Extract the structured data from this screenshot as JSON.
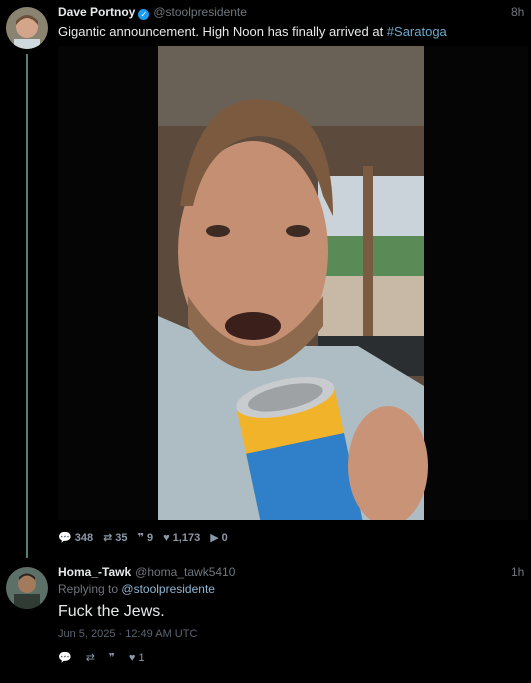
{
  "tweet": {
    "name": "Dave Portnoy",
    "handle": "@stoolpresidente",
    "time": "8h",
    "text": "Gigantic announcement.   High Noon has finally arrived at ",
    "hashtag": "#Saratoga",
    "stats": {
      "replies": "348",
      "retweets": "35",
      "quotes": "9",
      "likes": "1,173",
      "views": "0"
    }
  },
  "reply": {
    "name": "Homa_-Tawk",
    "handle": "@homa_tawk5410",
    "time": "1h",
    "replying_prefix": "Replying to",
    "replying_to": "@stoolpresidente",
    "text": "Fuck the Jews.",
    "date": "Jun 5, 2025 · 12:49 AM UTC",
    "likes": "1"
  },
  "icons": [
    "verified-icon",
    "reply-icon",
    "retweet-icon",
    "quote-icon",
    "like-icon",
    "views-icon"
  ],
  "colors": {
    "background": "#000000",
    "hashtag": "#6ea8c9",
    "thread_line": "#4f7f78"
  }
}
